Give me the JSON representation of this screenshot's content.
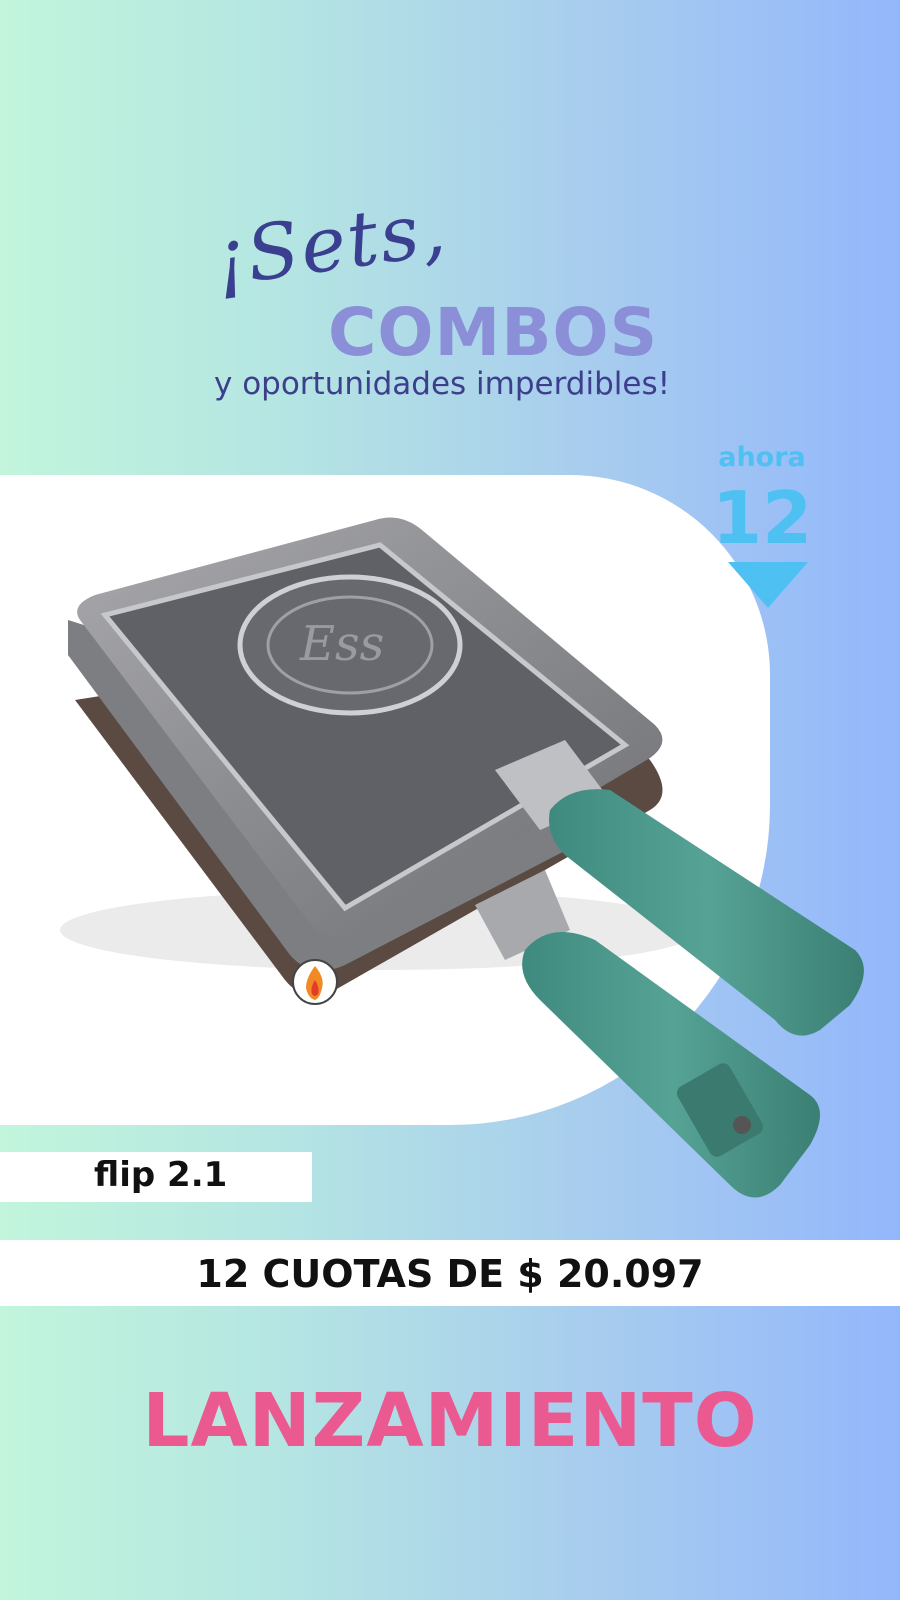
{
  "header": {
    "script_line": "¡Sets,",
    "combos": "COMBOS",
    "tagline": "y oportunidades imperdibles!"
  },
  "badge": {
    "top": "ahora",
    "number": "12"
  },
  "product": {
    "name": "flip 2.1",
    "price": "12 CUOTAS DE $ 20.097"
  },
  "footer": {
    "label": "LANZAMIENTO"
  },
  "colors": {
    "badge": "#4fc0f2",
    "handle": "#4a9a8c",
    "launch": "#ea5a90",
    "tagline": "#3e3f8c",
    "combos": "#8a8fd8"
  },
  "icons": [
    "down-arrow-icon",
    "fire-icon",
    "logo-icon"
  ]
}
